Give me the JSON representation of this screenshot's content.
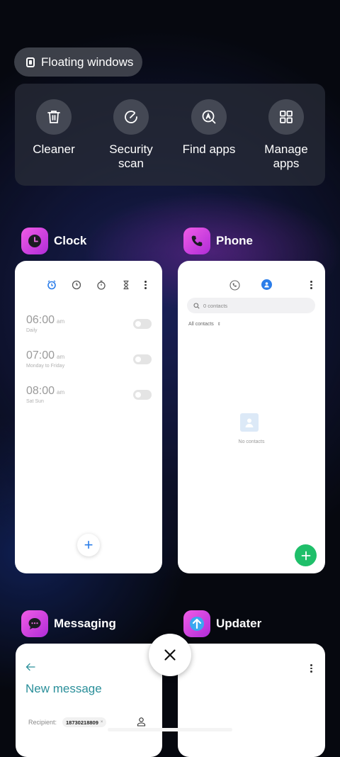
{
  "floating_windows": {
    "label": "Floating windows",
    "icon": "floating-window-icon"
  },
  "quick_actions": [
    {
      "label": "Cleaner",
      "icon": "trash-icon"
    },
    {
      "label": "Security scan",
      "icon": "security-scan-icon"
    },
    {
      "label": "Find apps",
      "icon": "find-apps-icon"
    },
    {
      "label": "Manage apps",
      "icon": "grid-icon"
    }
  ],
  "recent_apps": {
    "clock": {
      "name": "Clock",
      "icon": "clock-icon",
      "alarms": [
        {
          "time": "06:00",
          "ampm": "am",
          "repeat": "Daily"
        },
        {
          "time": "07:00",
          "ampm": "am",
          "repeat": "Monday to Friday"
        },
        {
          "time": "08:00",
          "ampm": "am",
          "repeat": "Sat Sun"
        }
      ],
      "add_label": "+"
    },
    "phone": {
      "name": "Phone",
      "icon": "phone-icon",
      "search_placeholder": "0 contacts",
      "filter_label": "All contacts",
      "empty_label": "No contacts",
      "fab_color": "#1fbf6a"
    },
    "messaging": {
      "name": "Messaging",
      "icon": "message-icon",
      "title": "New message",
      "recipient_label": "Recipient:",
      "recipient_chip": "18730218809"
    },
    "updater": {
      "name": "Updater",
      "icon": "updater-arrow-icon"
    }
  },
  "close_all": {
    "icon": "close-icon"
  },
  "colors": {
    "accent_blue": "#2b7de9",
    "app_icon_pink": "#e048e0",
    "messaging_teal": "#2a8f9a"
  }
}
